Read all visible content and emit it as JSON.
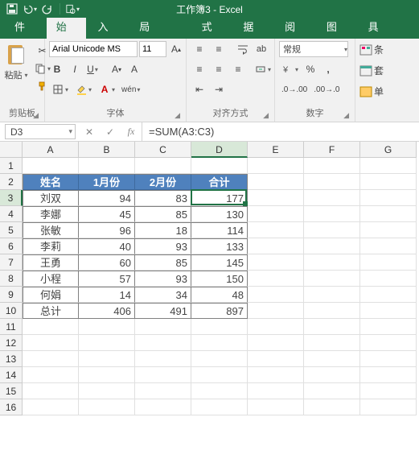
{
  "title": "工作簿3 - Excel",
  "tabs": [
    "文件",
    "开始",
    "插入",
    "页面布局",
    "公式",
    "数据",
    "审阅",
    "视图",
    "开发工具"
  ],
  "activeTab": 1,
  "ribbon": {
    "clipboard": {
      "paste": "粘贴",
      "label": "剪贴板"
    },
    "font": {
      "name": "Arial Unicode MS",
      "size": "11",
      "label": "字体"
    },
    "align": {
      "label": "对齐方式"
    },
    "number": {
      "format": "常规",
      "label": "数字"
    },
    "styles": {
      "cond": "条",
      "table": "套",
      "cell": "单"
    }
  },
  "namebox": "D3",
  "formula": "=SUM(A3:C3)",
  "cols": [
    "A",
    "B",
    "C",
    "D",
    "E",
    "F",
    "G"
  ],
  "rowCount": 16,
  "activeCol": 3,
  "activeRow": 3,
  "table": {
    "header": [
      "姓名",
      "1月份",
      "2月份",
      "合计"
    ],
    "rows": [
      [
        "刘双",
        "94",
        "83",
        "177"
      ],
      [
        "李娜",
        "45",
        "85",
        "130"
      ],
      [
        "张敏",
        "96",
        "18",
        "114"
      ],
      [
        "李莉",
        "40",
        "93",
        "133"
      ],
      [
        "王勇",
        "60",
        "85",
        "145"
      ],
      [
        "小程",
        "57",
        "93",
        "150"
      ],
      [
        "何娟",
        "14",
        "34",
        "48"
      ],
      [
        "总计",
        "406",
        "491",
        "897"
      ]
    ]
  },
  "chart_data": {
    "type": "table",
    "title": "",
    "columns": [
      "姓名",
      "1月份",
      "2月份",
      "合计"
    ],
    "rows": [
      {
        "姓名": "刘双",
        "1月份": 94,
        "2月份": 83,
        "合计": 177
      },
      {
        "姓名": "李娜",
        "1月份": 45,
        "2月份": 85,
        "合计": 130
      },
      {
        "姓名": "张敏",
        "1月份": 96,
        "2月份": 18,
        "合计": 114
      },
      {
        "姓名": "李莉",
        "1月份": 40,
        "2月份": 93,
        "合计": 133
      },
      {
        "姓名": "王勇",
        "1月份": 60,
        "2月份": 85,
        "合计": 145
      },
      {
        "姓名": "小程",
        "1月份": 57,
        "2月份": 93,
        "合计": 150
      },
      {
        "姓名": "何娟",
        "1月份": 14,
        "2月份": 34,
        "合计": 48
      },
      {
        "姓名": "总计",
        "1月份": 406,
        "2月份": 491,
        "合计": 897
      }
    ]
  }
}
